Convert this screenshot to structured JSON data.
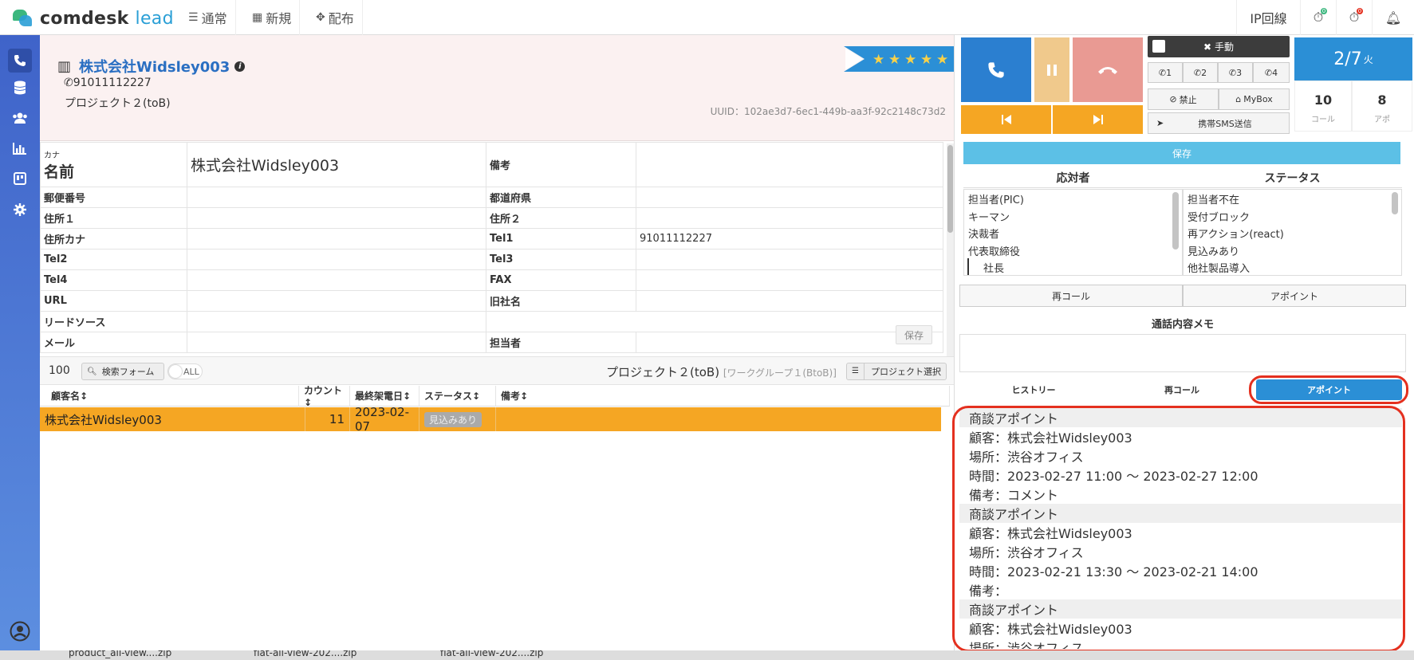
{
  "nav": {
    "logo_main": "comdesk",
    "logo_sub": "lead",
    "items": [
      {
        "icon": "list-icon",
        "label": "通常"
      },
      {
        "icon": "grid-icon",
        "label": "新規"
      },
      {
        "icon": "expand-icon",
        "label": "配布"
      }
    ],
    "ip_line": "IP回線",
    "badge_a": "0",
    "badge_b": "0"
  },
  "customer": {
    "name": "株式会社Widsley003",
    "phone": "91011112227",
    "project": "プロジェクト２(toB)",
    "uuid": "UUID：102ae3d7-6ec1-449b-aa3f-92c2148c73d2",
    "stars": 5
  },
  "fields": {
    "kana_label": "カナ",
    "name_label": "名前",
    "name_value": "株式会社Widsley003",
    "memo_label": "備考",
    "rows": [
      {
        "l1": "郵便番号",
        "v1": "",
        "l2": "都道府県",
        "v2": ""
      },
      {
        "l1": "住所１",
        "v1": "",
        "l2": "住所２",
        "v2": ""
      },
      {
        "l1": "住所カナ",
        "v1": "",
        "l2": "Tel1",
        "v2": "91011112227"
      },
      {
        "l1": "Tel2",
        "v1": "",
        "l2": "Tel3",
        "v2": ""
      },
      {
        "l1": "Tel4",
        "v1": "",
        "l2": "FAX",
        "v2": ""
      },
      {
        "l1": "URL",
        "v1": "",
        "l2": "旧社名",
        "v2": ""
      },
      {
        "l1": "リードソース",
        "v1": "",
        "l2": "",
        "v2": ""
      },
      {
        "l1": "メール",
        "v1": "",
        "l2": "担当者",
        "v2": ""
      }
    ],
    "save_label": "保存"
  },
  "listbar": {
    "count": "100",
    "search_label": "検索フォーム",
    "all_label": "ALL",
    "project": "プロジェクト２(toB)",
    "group": "[ワークグループ１(BtoB)]",
    "project_select": "プロジェクト選択"
  },
  "grid": {
    "headers": [
      "顧客名↕",
      "カウント↕",
      "最終架電日↕",
      "ステータス↕",
      "備考↕"
    ],
    "row": {
      "name": "株式会社Widsley003",
      "count": "11",
      "date": "2023-02-07",
      "status": "見込みあり",
      "memo": ""
    }
  },
  "phone": {
    "manual": "手動",
    "lines": [
      "1",
      "2",
      "3",
      "4"
    ],
    "ban": "禁止",
    "mybox": "MyBox",
    "sms": "携帯SMS送信",
    "date_main": "2/7",
    "date_day": "火",
    "calls": "10",
    "calls_label": "コール",
    "appts": "8",
    "appts_label": "アポ"
  },
  "right": {
    "save_label": "保存",
    "respondent_header": "応対者",
    "status_header": "ステータス",
    "respondents": [
      "担当者(PIC)",
      "キーマン",
      "決裁者",
      "代表取締役",
      "社長"
    ],
    "statuses": [
      "担当者不在",
      "受付ブロック",
      "再アクション(react)",
      "見込みあり",
      "他社製品導入"
    ],
    "recall": "再コール",
    "appoint": "アポイント",
    "memo_title": "通話内容メモ",
    "tabs": [
      "ヒストリー",
      "再コール",
      "アポイント"
    ],
    "appointments": [
      {
        "title": "商談アポイント",
        "customer": "顧客：株式会社Widsley003",
        "place": "場所：渋谷オフィス",
        "time": "時間：2023-02-27 11:00 〜 2023-02-27 12:00",
        "note": "備考：コメント"
      },
      {
        "title": "商談アポイント",
        "customer": "顧客：株式会社Widsley003",
        "place": "場所：渋谷オフィス",
        "time": "時間：2023-02-21 13:30 〜 2023-02-21 14:00",
        "note": "備考："
      },
      {
        "title": "商談アポイント",
        "customer": "顧客：株式会社Widsley003",
        "place": "場所：渋谷オフィス",
        "time": "",
        "note": ""
      }
    ]
  },
  "downloads": [
    "product_all-view....zip",
    "flat-all-view-202....zip",
    "flat-all-view-202....zip"
  ],
  "colors": {
    "brand": "#2a9fd6",
    "accent": "#f5a623",
    "danger": "#e4301f"
  }
}
